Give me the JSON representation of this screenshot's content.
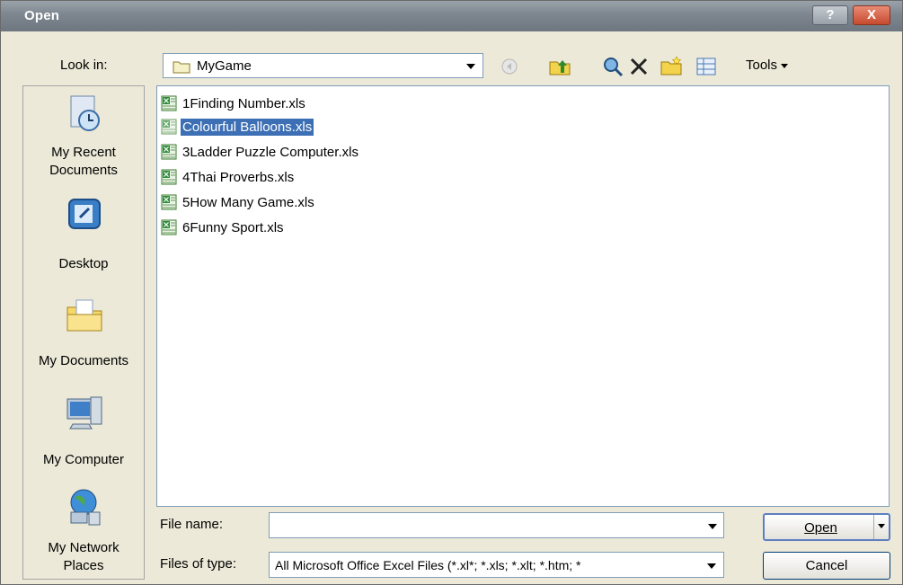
{
  "window": {
    "title": "Open"
  },
  "title_buttons": {
    "help": "?",
    "close": "X"
  },
  "look_in": {
    "label": "Look in:",
    "value": "MyGame"
  },
  "toolbar": {
    "icons": [
      "back-icon",
      "up-folder-icon",
      "search-web-icon",
      "delete-icon",
      "new-folder-icon",
      "views-icon"
    ],
    "tools_label": "Tools"
  },
  "places": [
    {
      "label_line1": "My Recent",
      "label_line2": "Documents"
    },
    {
      "label_line1": "Desktop",
      "label_line2": ""
    },
    {
      "label_line1": "My Documents",
      "label_line2": ""
    },
    {
      "label_line1": "My Computer",
      "label_line2": ""
    },
    {
      "label_line1": "My Network",
      "label_line2": "Places"
    }
  ],
  "files": [
    {
      "name": "1Finding Number.xls",
      "selected": false
    },
    {
      "name": "Colourful Balloons.xls",
      "selected": true
    },
    {
      "name": "3Ladder Puzzle Computer.xls",
      "selected": false
    },
    {
      "name": "4Thai Proverbs.xls",
      "selected": false
    },
    {
      "name": "5How Many Game.xls",
      "selected": false
    },
    {
      "name": "6Funny Sport.xls",
      "selected": false
    }
  ],
  "file_name": {
    "label": "File name:",
    "value": ""
  },
  "file_type": {
    "label": "Files of type:",
    "value": "All Microsoft Office Excel Files (*.xl*; *.xls; *.xlt; *.htm; *"
  },
  "buttons": {
    "open": "Open",
    "cancel": "Cancel"
  },
  "colors": {
    "selection": "#3d6fb5",
    "dialog_bg": "#ece9d8",
    "border": "#7f9db9"
  }
}
